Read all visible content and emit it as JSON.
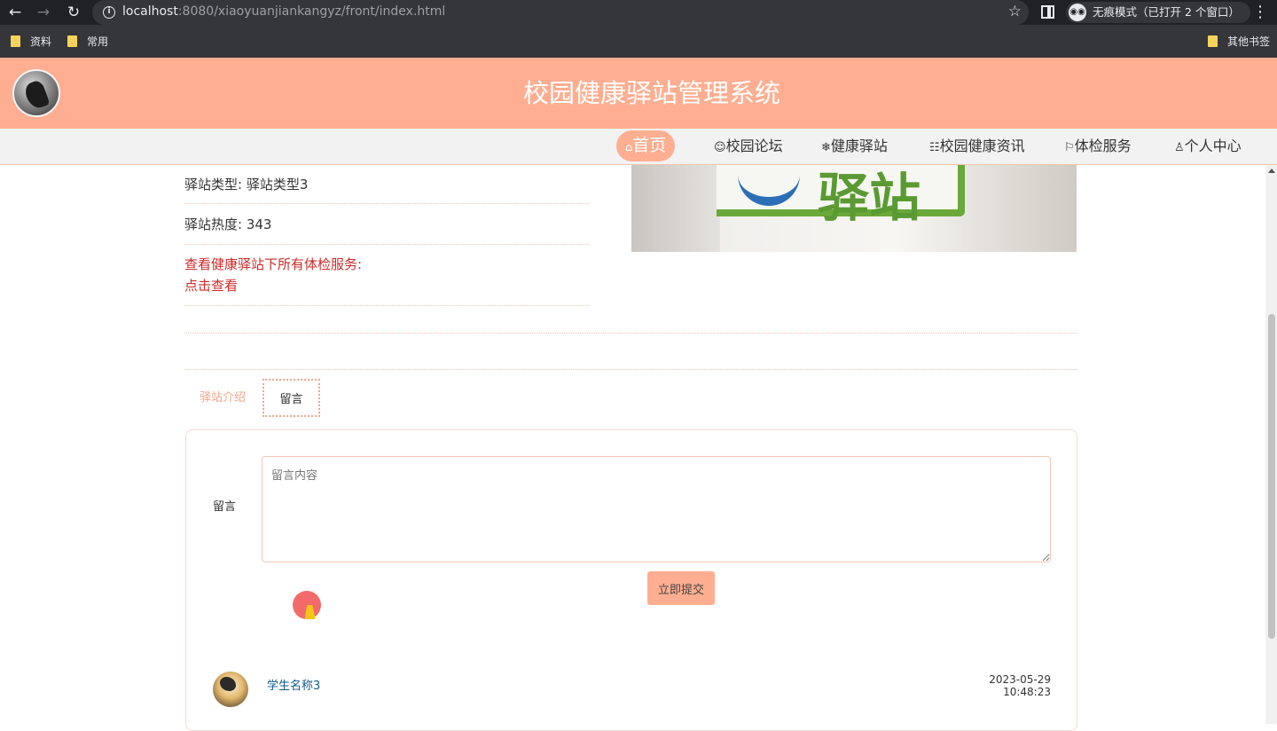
{
  "browser": {
    "url_host": "localhost",
    "url_rest": ":8080/xiaoyuanjiankangyz/front/index.html",
    "incognito_label": "无痕模式（已打开 2 个窗口）",
    "bookmarks": [
      "资料",
      "常用"
    ],
    "other_bookmarks": "其他书签"
  },
  "header": {
    "title": "校园健康驿站管理系统"
  },
  "nav": {
    "items": [
      {
        "icon": "⌂",
        "label": "首页"
      },
      {
        "icon": "☺",
        "label": "校园论坛"
      },
      {
        "icon": "❄",
        "label": "健康驿站"
      },
      {
        "icon": "☷",
        "label": "校园健康资讯"
      },
      {
        "icon": "⚐",
        "label": "体检服务"
      },
      {
        "icon": "♙",
        "label": "个人中心"
      }
    ],
    "active_index": 0
  },
  "station": {
    "type_label": "驿站类型: 驿站类型3",
    "heat_label": "驿站热度: 343",
    "service_link_label": "查看健康驿站下所有体检服务:",
    "service_link_action": "点击查看",
    "image_sign_text": "驿站"
  },
  "tabs": {
    "intro": "驿站介绍",
    "message": "留言"
  },
  "comment_form": {
    "label": "留言",
    "placeholder": "留言内容",
    "submit": "立即提交"
  },
  "comments": [
    {
      "user": "学生名称3",
      "time": "2023-05-29 10:48:23"
    }
  ],
  "colors": {
    "accent": "#ffae91",
    "link_red": "#cc2a2a",
    "username_blue": "#0e5a8a"
  }
}
